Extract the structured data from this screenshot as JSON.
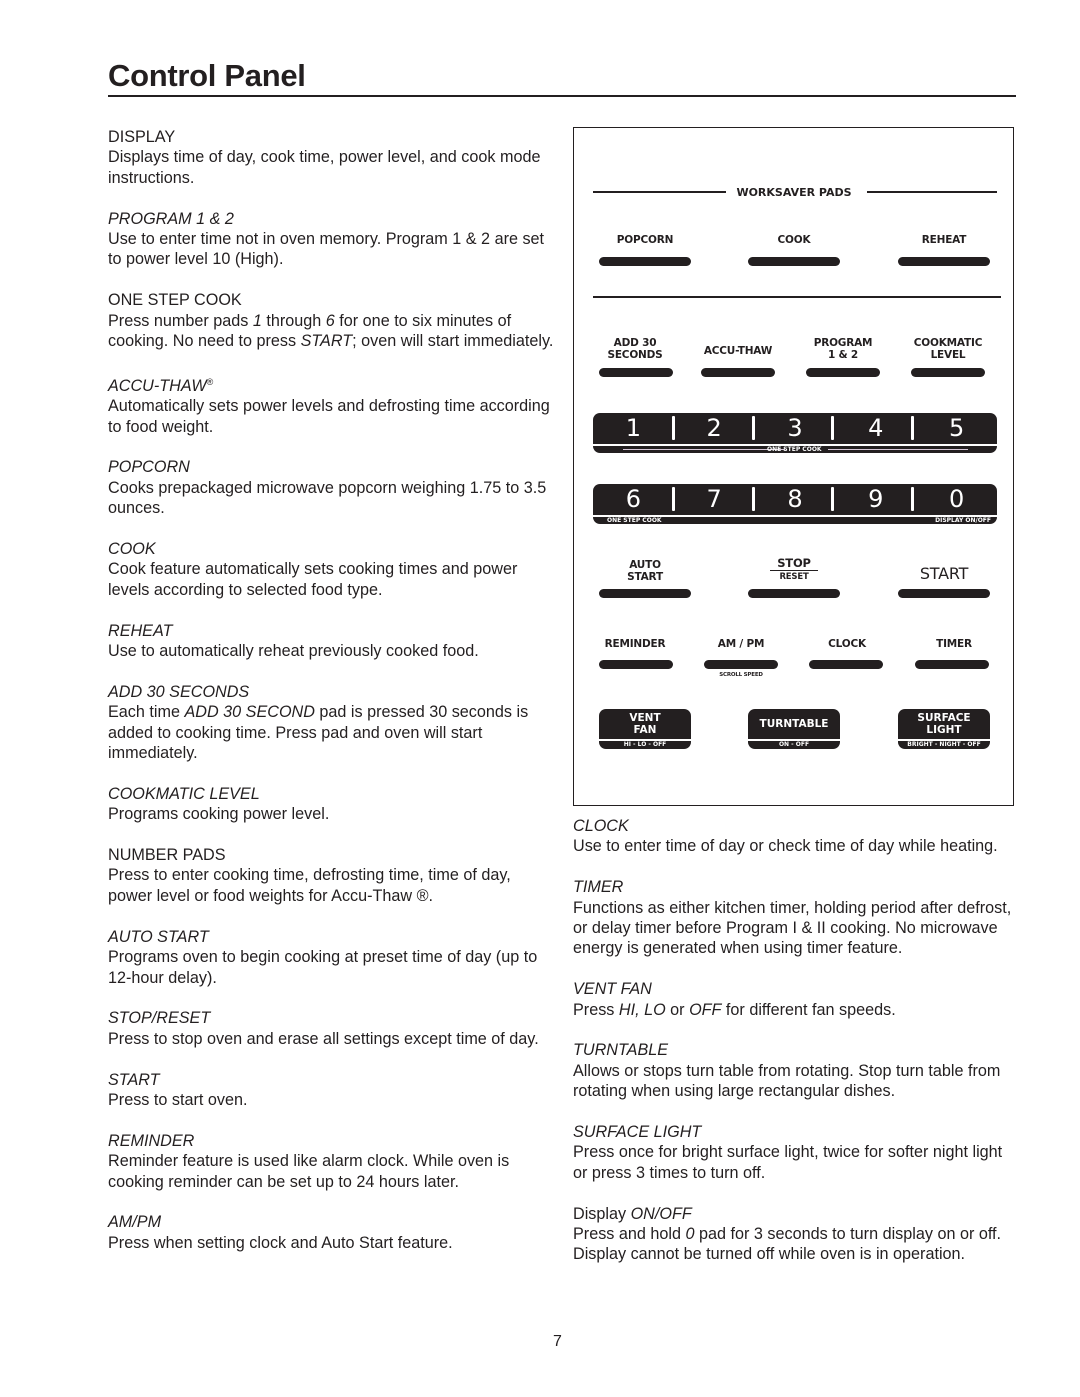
{
  "page": {
    "title": "Control Panel",
    "page_number": "7"
  },
  "left_entries": [
    {
      "head": "DISPLAY",
      "italic": false,
      "desc": "Displays time of day, cook time, power level, and cook mode instructions."
    },
    {
      "head": "PROGRAM 1 & 2",
      "italic": true,
      "desc": "Use to enter time not in oven memory.  Program 1 & 2 are set to power level 10 (High)."
    },
    {
      "head": "ONE STEP COOK",
      "italic": false,
      "desc_parts": [
        {
          "t": "Press number pads ",
          "i": false
        },
        {
          "t": "1",
          "i": true
        },
        {
          "t": " through ",
          "i": false
        },
        {
          "t": "6",
          "i": true
        },
        {
          "t": " for one to six minutes of cooking. No need to press ",
          "i": false
        },
        {
          "t": "START",
          "i": true
        },
        {
          "t": "; oven will start immediately.",
          "i": false
        }
      ]
    },
    {
      "head": "ACCU-THAW",
      "head_mark": "®",
      "italic": true,
      "desc": "Automatically sets power levels and defrosting time according to food weight."
    },
    {
      "head": "POPCORN",
      "italic": true,
      "desc": "Cooks prepackaged microwave popcorn weighing 1.75 to 3.5 ounces."
    },
    {
      "head": "COOK",
      "italic": true,
      "desc": "Cook feature automatically sets cooking times and power levels according to selected food type."
    },
    {
      "head": "REHEAT",
      "italic": true,
      "desc": "Use to automatically reheat previously cooked food."
    },
    {
      "head": "ADD 30 SECONDS",
      "italic": true,
      "desc_parts": [
        {
          "t": "Each time ",
          "i": false
        },
        {
          "t": "ADD 30 SECOND",
          "i": true
        },
        {
          "t": " pad is pressed 30 seconds is added to cooking time. Press pad and oven will start immediately.",
          "i": false
        }
      ]
    },
    {
      "head": "COOKMATIC LEVEL",
      "italic": true,
      "desc": "Programs cooking power level."
    },
    {
      "head": "NUMBER PADS",
      "italic": false,
      "desc": "Press to enter cooking time, defrosting time, time of day, power level or food weights for Accu-Thaw ®."
    },
    {
      "head": "AUTO START",
      "italic": true,
      "desc": "Programs oven to begin cooking at preset time of day (up to 12-hour delay)."
    },
    {
      "head": "STOP/RESET",
      "italic": true,
      "desc": "Press to stop oven and erase all settings except time of day."
    },
    {
      "head": "START",
      "italic": true,
      "desc": "Press to start oven."
    },
    {
      "head": "REMINDER",
      "italic": true,
      "desc": "Reminder feature is used like alarm clock. While oven is cooking reminder can be set up to 24 hours later."
    },
    {
      "head": "AM/PM",
      "italic": true,
      "desc": "Press when setting clock and Auto Start feature."
    }
  ],
  "right_entries": [
    {
      "head": "CLOCK",
      "italic": true,
      "desc": "Use to enter time of day or check time of day while heating."
    },
    {
      "head": "TIMER",
      "italic": true,
      "desc": "Functions as either kitchen timer, holding period after defrost, or delay timer before Program I & II cooking. No microwave energy is generated when using timer feature."
    },
    {
      "head": "VENT FAN",
      "italic": true,
      "desc_parts": [
        {
          "t": "Press ",
          "i": false
        },
        {
          "t": "HI, LO",
          "i": true
        },
        {
          "t": " or ",
          "i": false
        },
        {
          "t": "OFF",
          "i": true
        },
        {
          "t": " for different fan speeds.",
          "i": false
        }
      ]
    },
    {
      "head": "TURNTABLE",
      "italic": true,
      "desc": "Allows or stops turn table from rotating. Stop turn table from rotating when using large rectangular dishes."
    },
    {
      "head": "SURFACE LIGHT",
      "italic": true,
      "desc": "Press once for bright surface light, twice for softer night light or press 3 times to turn off."
    },
    {
      "head_parts": [
        {
          "t": "Display ",
          "i": false
        },
        {
          "t": "ON/OFF",
          "i": true
        }
      ],
      "desc_parts": [
        {
          "t": "Press and hold  ",
          "i": false
        },
        {
          "t": "0",
          "i": true
        },
        {
          "t": " pad for 3 seconds to turn display on or off.  Display cannot be turned off while oven is in operation.",
          "i": false
        }
      ]
    }
  ],
  "panel": {
    "worksaver_label": "WORKSAVER PADS",
    "row1": [
      "POPCORN",
      "COOK",
      "REHEAT"
    ],
    "row2": [
      {
        "line1": "ADD 30",
        "line2": "SECONDS"
      },
      {
        "line1": "ACCU-THAW",
        "line2": ""
      },
      {
        "line1": "PROGRAM",
        "line2": "1 & 2"
      },
      {
        "line1": "COOKMATIC",
        "line2": "LEVEL"
      }
    ],
    "numbers_top": [
      "1",
      "2",
      "3",
      "4",
      "5"
    ],
    "numbers_top_caption": "ONE STEP COOK",
    "numbers_bottom": [
      "6",
      "7",
      "8",
      "9",
      "0"
    ],
    "numbers_bottom_left_caption": "ONE STEP COOK",
    "numbers_bottom_right_caption": "DISPLAY ON/OFF",
    "auto_start": {
      "line1": "AUTO",
      "line2": "START"
    },
    "stop_reset": {
      "line1": "STOP",
      "line2": "RESET"
    },
    "start": "START",
    "row5": [
      "REMINDER",
      "AM / PM",
      "CLOCK",
      "TIMER"
    ],
    "scroll_speed": "SCROLL SPEED",
    "vent_fan": {
      "line1": "VENT",
      "line2": "FAN",
      "sub": "HI - LO - OFF"
    },
    "turntable": {
      "line1": "TURNTABLE",
      "sub": "ON - OFF"
    },
    "surface_light": {
      "line1": "SURFACE",
      "line2": "LIGHT",
      "sub": "BRIGHT - NIGHT - OFF"
    }
  }
}
